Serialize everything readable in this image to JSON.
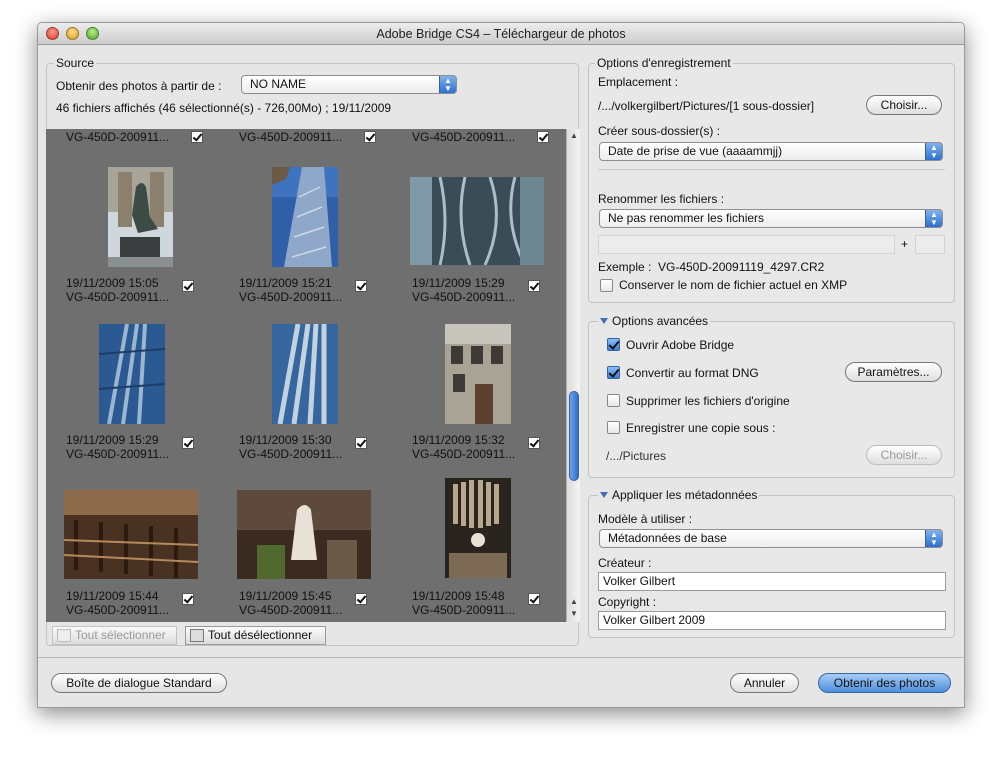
{
  "window": {
    "title": "Adobe Bridge CS4 – Téléchargeur de photos"
  },
  "source": {
    "legend": "Source",
    "obtain_label": "Obtenir des photos à partir de :",
    "obtain_value": "NO NAME",
    "summary": "46 fichiers affichés (46 sélectionné(s) - 726,00Mo) ; 19/11/2009"
  },
  "grid": {
    "top_captions": [
      "VG-450D-200911...",
      "VG-450D-200911...",
      "VG-450D-200911..."
    ],
    "items": [
      {
        "date": "19/11/2009 15:05",
        "name": "VG-450D-200911...",
        "checked": true,
        "thumb": "statue-icon"
      },
      {
        "date": "19/11/2009 15:21",
        "name": "VG-450D-200911...",
        "checked": true,
        "thumb": "tower-photo"
      },
      {
        "date": "19/11/2009 15:29",
        "name": "VG-450D-200911...",
        "checked": true,
        "thumb": "reflection-photo"
      },
      {
        "date": "19/11/2009 15:29",
        "name": "VG-450D-200911...",
        "checked": true,
        "thumb": "pipes-photo"
      },
      {
        "date": "19/11/2009 15:30",
        "name": "VG-450D-200911...",
        "checked": true,
        "thumb": "pipes-photo"
      },
      {
        "date": "19/11/2009 15:32",
        "name": "VG-450D-200911...",
        "checked": true,
        "thumb": "building-photo"
      },
      {
        "date": "19/11/2009 15:44",
        "name": "VG-450D-200911...",
        "checked": true,
        "thumb": "chairs-photo"
      },
      {
        "date": "19/11/2009 15:45",
        "name": "VG-450D-200911...",
        "checked": true,
        "thumb": "madonna-photo"
      },
      {
        "date": "19/11/2009 15:48",
        "name": "VG-450D-200911...",
        "checked": true,
        "thumb": "organ-photo"
      }
    ],
    "select_all": "Tout sélectionner",
    "deselect_all": "Tout désélectionner"
  },
  "save_options": {
    "legend": "Options d'enregistrement",
    "location_label": "Emplacement :",
    "location_path": "/.../volkergilbert/Pictures/[1 sous-dossier]",
    "choose_button": "Choisir...",
    "subfolder_label": "Créer sous-dossier(s) :",
    "subfolder_value": "Date de prise de vue (aaaammjj)",
    "rename_label": "Renommer les fichiers :",
    "rename_value": "Ne pas renommer les fichiers",
    "plus": "+",
    "example_label": "Exemple :",
    "example_value": "VG-450D-20091119_4297.CR2",
    "keep_name_label": "Conserver le nom de fichier actuel en XMP",
    "keep_name_checked": false
  },
  "advanced": {
    "legend": "Options avancées",
    "open_bridge": "Ouvrir Adobe Bridge",
    "open_bridge_checked": true,
    "convert_dng": "Convertir au format DNG",
    "convert_dng_checked": true,
    "params_button": "Paramètres...",
    "delete_originals": "Supprimer les fichiers d'origine",
    "delete_originals_checked": false,
    "save_copy": "Enregistrer une copie sous :",
    "save_copy_checked": false,
    "copy_path": "/.../Pictures",
    "copy_choose_button": "Choisir..."
  },
  "metadata": {
    "legend": "Appliquer les métadonnées",
    "template_label": "Modèle à utiliser :",
    "template_value": "Métadonnées de base",
    "creator_label": "Créateur :",
    "creator_value": "Volker Gilbert",
    "copyright_label": "Copyright :",
    "copyright_value": "Volker Gilbert 2009"
  },
  "footer": {
    "standard_dialog": "Boîte de dialogue Standard",
    "cancel": "Annuler",
    "get_photos": "Obtenir des photos"
  }
}
